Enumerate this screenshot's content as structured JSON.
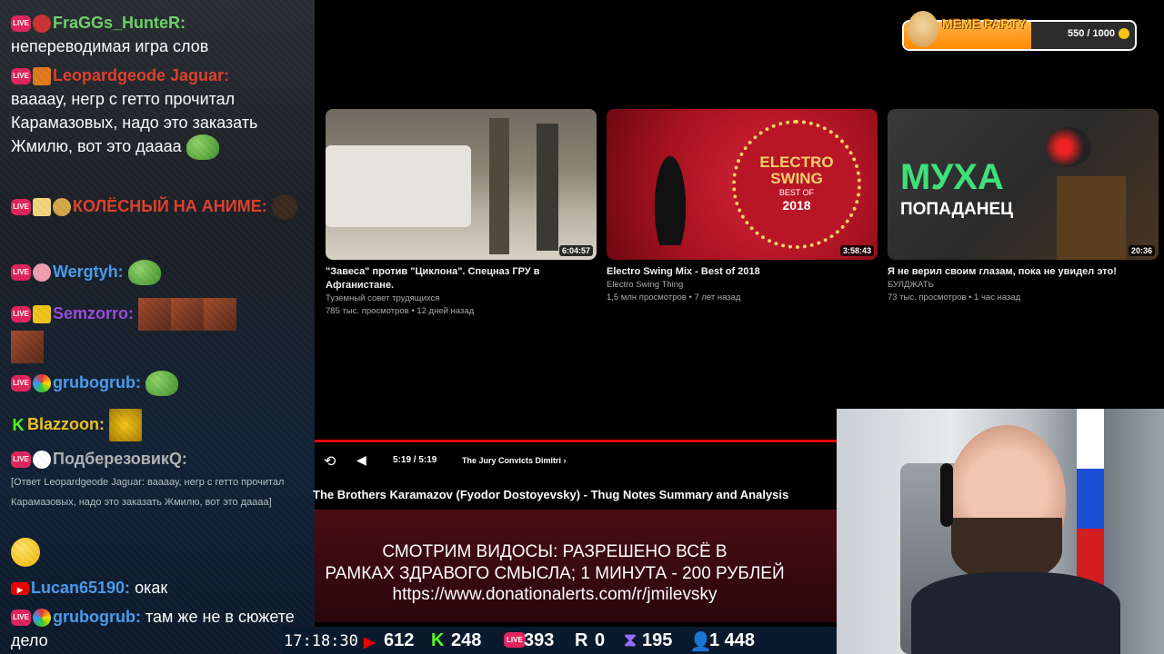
{
  "chat": {
    "messages": [
      {
        "user": "FraGGs_HunteR:",
        "text": "непереводимая игра слов",
        "color": "#6fd36a"
      },
      {
        "user": "Leopardgeode Jaguar:",
        "text": "ваааау, негр с гетто прочитал Карамазовых, надо это заказать Жмилю, вот это даааа",
        "color": "#e0412c"
      },
      {
        "user": "КОЛЁСНЫЙ НА АНИМЕ:",
        "text": "",
        "color": "#e0412c"
      },
      {
        "user": "Wergtyh:",
        "text": "",
        "color": "#4a9df0"
      },
      {
        "user": "Semzorro:",
        "text": "",
        "color": "#9b4ddb"
      },
      {
        "user": "grubogrub:",
        "text": "",
        "color": "#4a9df0"
      },
      {
        "user": "Blazzoon:",
        "text": "",
        "color": "#f0c419"
      },
      {
        "user": "ПодберезовикQ:",
        "text": "",
        "color": "#b3b3b3"
      },
      {
        "reply": "[Ответ Leopardgeode Jaguar: ваааау, негр с гетто прочитал Карамазовых, надо это заказать Жмилю, вот это даааа]"
      },
      {
        "user": "Lucan65190:",
        "text": "окак",
        "color": "#4a9df0"
      },
      {
        "user": "grubogrub:",
        "text": "там же не в сюжете дело",
        "color": "#4a9df0"
      }
    ]
  },
  "meme_party": {
    "title": "MEME PARTY",
    "count": "550 / 1000",
    "progress": 0.55
  },
  "videos": [
    {
      "title": "\"Завеса\" против \"Циклона\". Спецназ ГРУ в Афганистане.",
      "channel": "Туземный совет трудящихся",
      "meta": "785 тыс. просмотров • 12 дней назад",
      "duration": "6:04:57"
    },
    {
      "title": "Electro Swing Mix - Best of 2018",
      "channel": "Electro Swing Thing",
      "meta": "1,5 млн просмотров • 7 лет назад",
      "duration": "3:58:43",
      "thumb_text": [
        "ELECTRO",
        "SWING",
        "BEST OF",
        "2018"
      ]
    },
    {
      "title": "Я не верил своим глазам, пока не увидел это!",
      "channel": "БУЛДЖАТЬ",
      "meta": "73 тыс. просмотров • 1 час назад",
      "duration": "20:36",
      "thumb_text": [
        "МУХА",
        "ПОПАДАНЕЦ"
      ]
    }
  ],
  "player": {
    "time": "5:19 / 5:19",
    "chapter": "The Jury Convicts Dimitri",
    "title": "The Brothers Karamazov (Fyodor Dostoyevsky) - Thug Notes Summary and Analysis"
  },
  "banner": {
    "line1": "СМОТРИМ ВИДОСЫ: РАЗРЕШЕНО ВСЁ В",
    "line2": "РАМКАХ ЗДРАВОГО СМЫСЛА; 1 МИНУТА - 200 РУБЛЕЙ",
    "line3": "https://www.donationalerts.com/r/jmilevsky"
  },
  "status": {
    "clock": "17:18:30",
    "youtube": "612",
    "kick": "248",
    "vk": "393",
    "rutube": "0",
    "twitch": "195",
    "viewers": "1 448"
  }
}
